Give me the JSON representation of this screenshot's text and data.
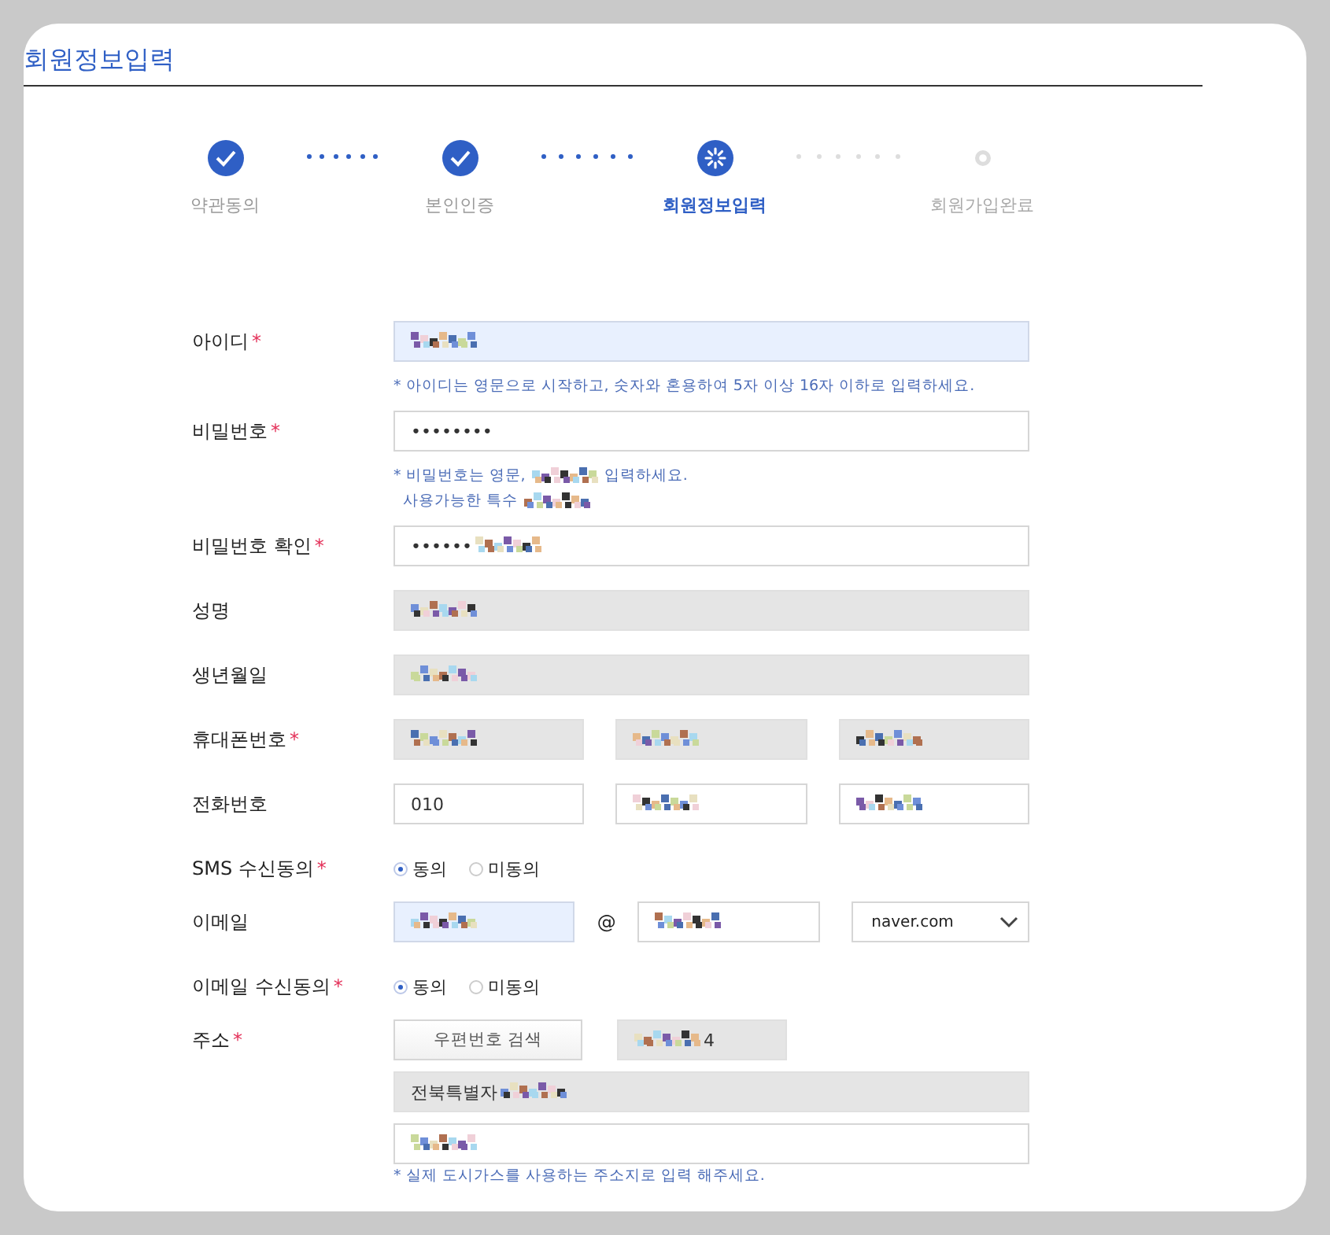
{
  "page_title": "회원정보입력",
  "steps": [
    {
      "label": "약관동의",
      "kind": "done"
    },
    {
      "label": "본인인증",
      "kind": "done"
    },
    {
      "label": "회원정보입력",
      "kind": "current"
    },
    {
      "label": "회원가입완료",
      "kind": "todo"
    }
  ],
  "form": {
    "rows": [
      {
        "kind": "fields",
        "label": "아이디",
        "required_mark": "*",
        "fields": [
          {
            "kind": "autofilled",
            "redacted": true
          }
        ],
        "hint_lines": [
          [
            "* 아이디는 영문으로 시작하고, 숫자와 혼용하여 5자 이상 16자 이하로 입력하세요."
          ]
        ]
      },
      {
        "kind": "fields",
        "label": "비밀번호",
        "required_mark": "*",
        "fields": [
          {
            "kind": "input",
            "value": "••••••••",
            "redacted": false
          }
        ],
        "hint_lines": [
          [
            "* 비밀번호는 영문,",
            "입력하세요."
          ],
          [
            "사용가능한 특수"
          ]
        ]
      },
      {
        "kind": "fields",
        "label": "비밀번호 확인",
        "required_mark": "*",
        "fields": [
          {
            "kind": "input",
            "value": "••••••",
            "redacted": true
          }
        ]
      },
      {
        "kind": "fields",
        "label": "성명",
        "fields": [
          {
            "kind": "readonly",
            "redacted": true
          }
        ]
      },
      {
        "kind": "fields",
        "label": "생년월일",
        "fields": [
          {
            "kind": "readonly",
            "redacted": true
          }
        ]
      },
      {
        "kind": "fields",
        "label": "휴대폰번호",
        "required_mark": "*",
        "fields": [
          {
            "kind": "readonly",
            "redacted": true
          },
          {
            "kind": "readonly",
            "redacted": true
          },
          {
            "kind": "readonly",
            "redacted": true
          }
        ]
      },
      {
        "kind": "fields",
        "label": "전화번호",
        "fields": [
          {
            "kind": "input",
            "value": "010",
            "redacted": false
          },
          {
            "kind": "input",
            "redacted": true
          },
          {
            "kind": "input",
            "redacted": true
          }
        ]
      },
      {
        "kind": "radio",
        "label": "SMS 수신동의",
        "required_mark": "*",
        "options": [
          {
            "label": "동의",
            "selected": true
          },
          {
            "label": "미동의",
            "selected": false
          }
        ]
      },
      {
        "kind": "email",
        "label": "이메일",
        "fields": [
          {
            "kind": "autofilled",
            "redacted": true
          },
          {
            "kind": "input",
            "redacted": true
          }
        ],
        "separator": "@",
        "domain": "naver.com"
      },
      {
        "kind": "radio",
        "label": "이메일 수신동의",
        "required_mark": "*",
        "options": [
          {
            "label": "동의",
            "selected": true
          },
          {
            "label": "미동의",
            "selected": false
          }
        ]
      },
      {
        "kind": "address",
        "label": "주소",
        "required_mark": "*",
        "button": "우편번호 검색",
        "zip": {
          "kind": "readonly",
          "value": "4",
          "redacted": true
        },
        "lines": [
          {
            "kind": "readonly",
            "value": "전북특별자",
            "redacted": true
          },
          {
            "kind": "input",
            "redacted": true
          }
        ],
        "hint_lines": [
          [
            "* 실제 도시가스를 사용하는 주소지로 입력 해주세요."
          ]
        ]
      }
    ]
  }
}
